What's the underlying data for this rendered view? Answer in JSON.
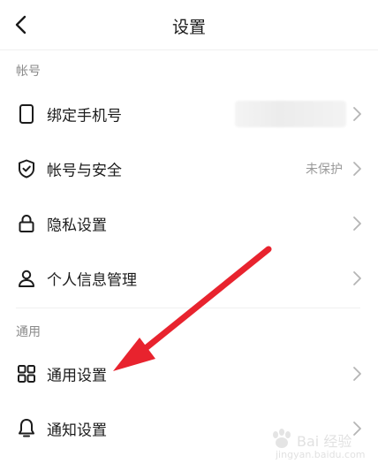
{
  "header": {
    "title": "设置"
  },
  "sections": [
    {
      "label": "帐号",
      "items": [
        {
          "label": "绑定手机号",
          "icon": "phone-icon",
          "value": ""
        },
        {
          "label": "帐号与安全",
          "icon": "shield-check-icon",
          "value": "未保护"
        },
        {
          "label": "隐私设置",
          "icon": "lock-icon",
          "value": ""
        },
        {
          "label": "个人信息管理",
          "icon": "person-icon",
          "value": ""
        }
      ]
    },
    {
      "label": "通用",
      "items": [
        {
          "label": "通用设置",
          "icon": "grid-icon",
          "value": ""
        },
        {
          "label": "通知设置",
          "icon": "bell-icon",
          "value": ""
        }
      ]
    }
  ],
  "annotation": {
    "color": "#e8232e"
  },
  "watermark": {
    "brand": "Bai 经验",
    "url": "jingyan.baidu.com"
  }
}
